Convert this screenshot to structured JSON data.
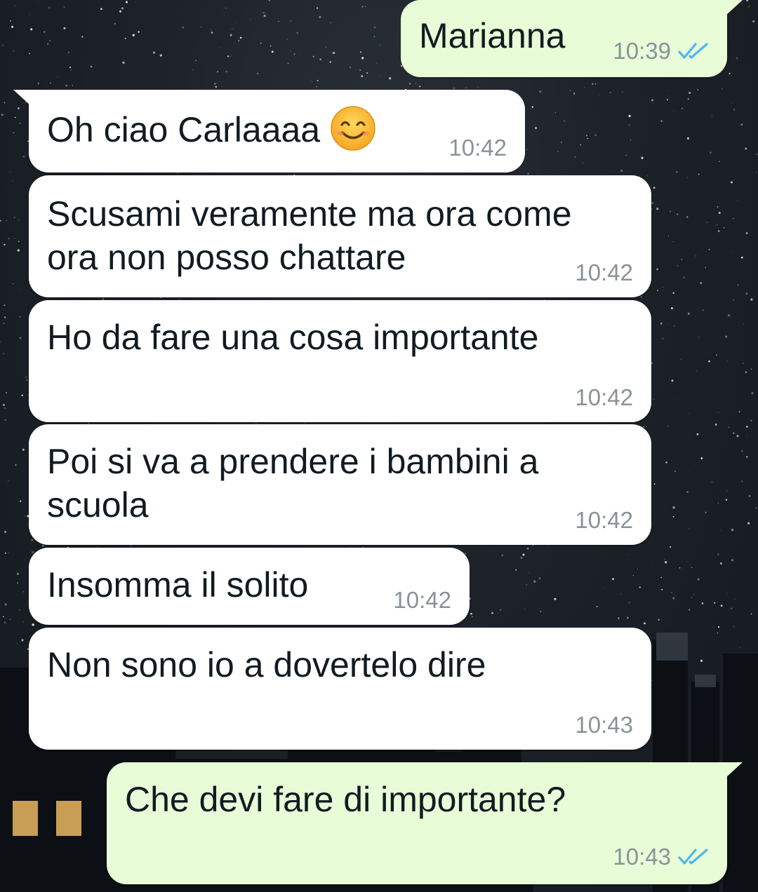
{
  "chat": {
    "messages": [
      {
        "direction": "outgoing",
        "text": "Marianna",
        "time": "10:39",
        "status": "read"
      },
      {
        "direction": "incoming",
        "text": "Oh ciao Carlaaaa",
        "emoji": "smiling-face-icon",
        "time": "10:42"
      },
      {
        "direction": "incoming",
        "text_line1": "Scusami veramente ma ora come",
        "text_line2": "ora non posso chattare",
        "time": "10:42"
      },
      {
        "direction": "incoming",
        "text": "Ho da fare una cosa importante",
        "time": "10:42"
      },
      {
        "direction": "incoming",
        "text_line1": "Poi si va a prendere i bambini a",
        "text_line2": "scuola",
        "time": "10:42"
      },
      {
        "direction": "incoming",
        "text": "Insomma il solito",
        "time": "10:42"
      },
      {
        "direction": "incoming",
        "text": "Non sono io a dovertelo dire",
        "time": "10:43"
      },
      {
        "direction": "outgoing",
        "text": "Che devi fare di importante?",
        "time": "10:43",
        "status": "read"
      }
    ]
  },
  "colors": {
    "incoming_bubble": "#ffffff",
    "outgoing_bubble": "#e7fcd7",
    "read_tick": "#4fb6ec",
    "timestamp": "#8a9298"
  }
}
